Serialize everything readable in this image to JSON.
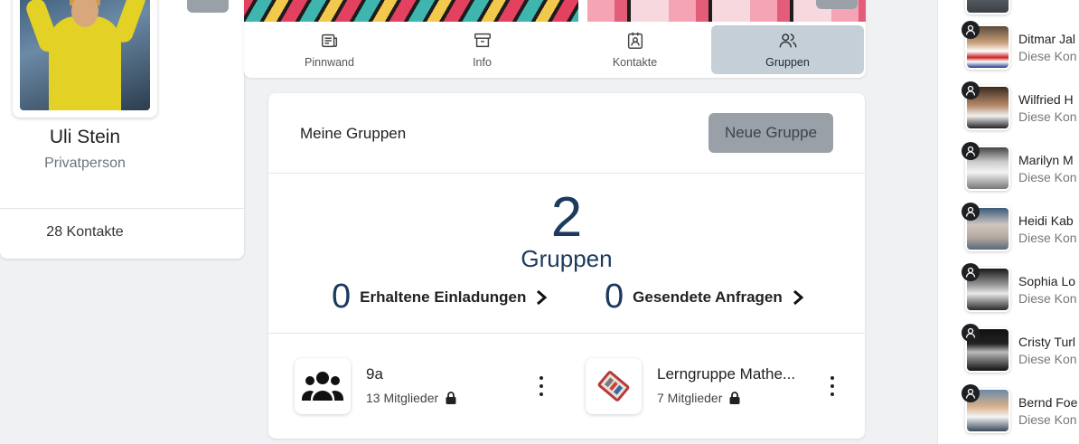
{
  "profile": {
    "name": "Uli Stein",
    "type": "Privatperson",
    "contacts_count": "28 Kontakte"
  },
  "tabs": [
    {
      "label": "Pinnwand",
      "icon": "newspaper-icon",
      "active": false
    },
    {
      "label": "Info",
      "icon": "archive-box-icon",
      "active": false
    },
    {
      "label": "Kontakte",
      "icon": "contact-card-icon",
      "active": false
    },
    {
      "label": "Gruppen",
      "icon": "users-icon",
      "active": true
    }
  ],
  "groups_section": {
    "title": "Meine Gruppen",
    "new_group_label": "Neue Gruppe",
    "count": "2",
    "count_label": "Gruppen",
    "received_invites": {
      "number": "0",
      "label": "Erhaltene Einladungen"
    },
    "sent_requests": {
      "number": "0",
      "label": "Gesendete Anfragen"
    },
    "items": [
      {
        "name": "9a",
        "members": "13 Mitglieder",
        "icon": "users-group-icon"
      },
      {
        "name": "Lerngruppe Mathe...",
        "members": "7 Mitglieder",
        "icon": "math-tools-image"
      }
    ]
  },
  "contacts": [
    {
      "name": "Ditmar Jal",
      "status": "Diese Kon"
    },
    {
      "name": "Wilfried H",
      "status": "Diese Kon"
    },
    {
      "name": "Marilyn M",
      "status": "Diese Kon"
    },
    {
      "name": "Heidi Kab",
      "status": "Diese Kon"
    },
    {
      "name": "Sophia Lo",
      "status": "Diese Kon"
    },
    {
      "name": "Cristy Turl",
      "status": "Diese Kon"
    },
    {
      "name": "Bernd Foe",
      "status": "Diese Kon"
    }
  ],
  "colors": {
    "accent_navy": "#1c3a5e",
    "active_tab_bg": "#c5cfd8",
    "button_gray": "#9aa0a8"
  }
}
